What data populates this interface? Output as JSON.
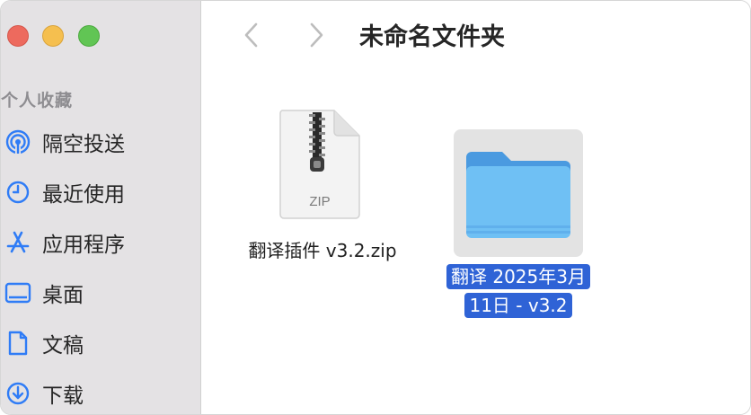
{
  "window": {
    "title": "未命名文件夹"
  },
  "sidebar": {
    "section_header": "个人收藏",
    "items": [
      {
        "label": "隔空投送",
        "icon": "airdrop-icon"
      },
      {
        "label": "最近使用",
        "icon": "clock-icon"
      },
      {
        "label": "应用程序",
        "icon": "applications-icon"
      },
      {
        "label": "桌面",
        "icon": "desktop-icon"
      },
      {
        "label": "文稿",
        "icon": "document-icon"
      },
      {
        "label": "下载",
        "icon": "download-icon"
      }
    ]
  },
  "toolbar": {
    "back_icon": "chevron-left-icon",
    "forward_icon": "chevron-right-icon"
  },
  "files": [
    {
      "name": "翻译插件 v3.2.zip",
      "type": "zip",
      "icon_text": "ZIP",
      "selected": false
    },
    {
      "name_line1": "翻译 2025年3月",
      "name_line2": "11日 - v3.2",
      "type": "folder",
      "selected": true
    }
  ],
  "colors": {
    "accent": "#2f63d6",
    "sidebar_icon": "#2f7cf6",
    "folder": "#6bb8f0"
  }
}
